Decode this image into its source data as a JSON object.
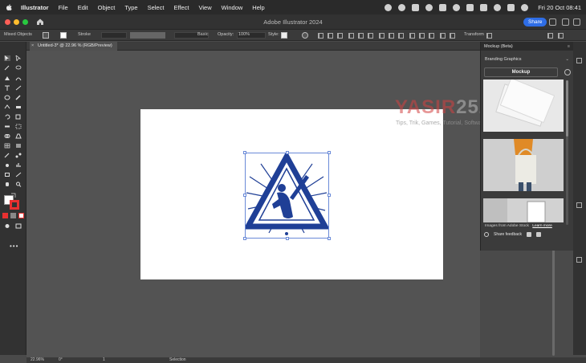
{
  "menubar": {
    "app_name": "Illustrator",
    "items": [
      "File",
      "Edit",
      "Object",
      "Type",
      "Select",
      "Effect",
      "View",
      "Window",
      "Help"
    ],
    "clock": "Fri 20 Oct  08:41"
  },
  "window": {
    "title": "Adobe Illustrator 2024",
    "share_label": "Share"
  },
  "control_bar": {
    "selection_label": "Mixed Objects",
    "stroke_label": "Stroke",
    "stroke_style": "Basic",
    "opacity_label": "Opacity:",
    "opacity_value": "100%",
    "style_label": "Style:",
    "transform_label": "Transform"
  },
  "document_tab": {
    "title": "Untitled-3* @ 22.96 % (RGB/Preview)",
    "close_glyph": "×"
  },
  "watermark": {
    "title_red": "YASIR",
    "title_gray": "252",
    "subtitle": "Tips, Trik, Games, Tutorial, Software, Tools"
  },
  "mockup_panel": {
    "title": "Mockup (Beta)",
    "category": "Branding Graphics",
    "mockup_button": "Mockup",
    "stock_text": "Images from Adobe Stock",
    "learn_more": "Learn more",
    "feedback_label": "Share feedback"
  },
  "status_bar": {
    "zoom": "22.96%",
    "rotation": "0°",
    "artboard_num": "1",
    "tool": "Selection"
  },
  "colors": {
    "accent": "#2e6de6",
    "emblem_blue": "#1f3f96",
    "watermark_red": "#d24141"
  }
}
